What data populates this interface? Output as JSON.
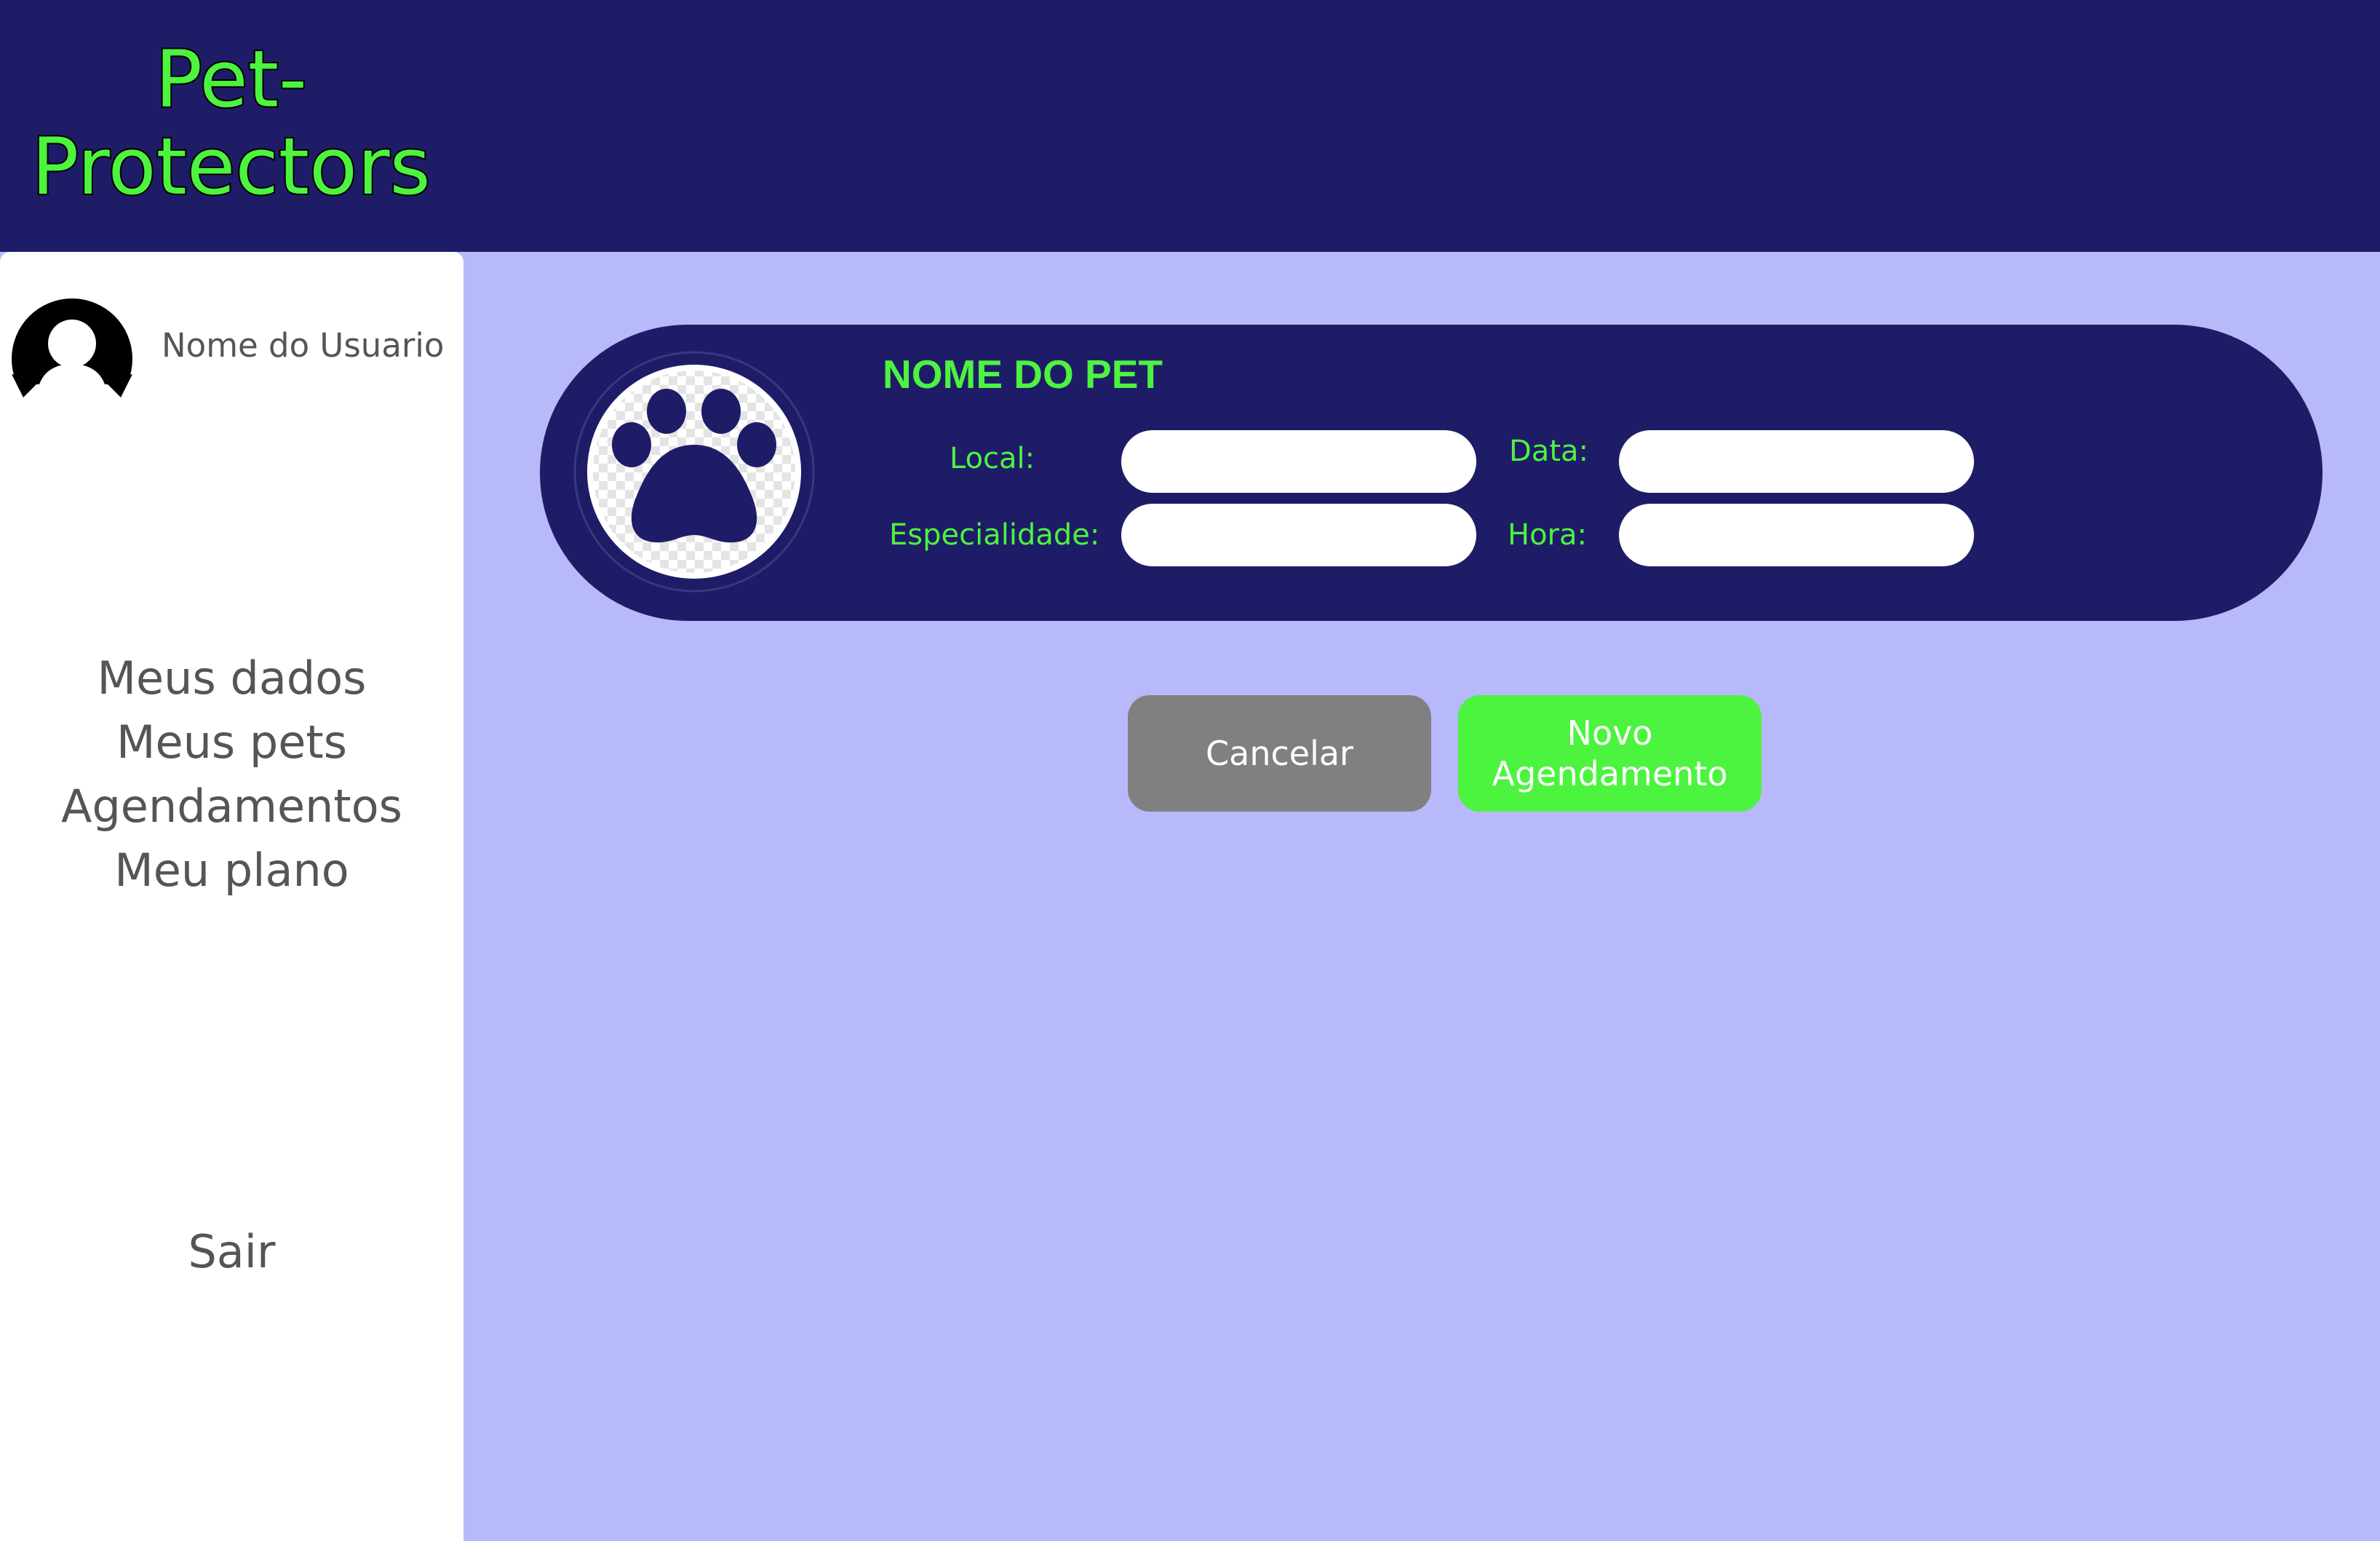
{
  "app": {
    "logo_line1": "Pet-",
    "logo_line2": "Protectors"
  },
  "sidebar": {
    "user_name": "Nome do Usuario",
    "items": [
      {
        "label": "Meus dados"
      },
      {
        "label": "Meus pets"
      },
      {
        "label": "Agendamentos"
      },
      {
        "label": "Meu plano"
      }
    ],
    "logout_label": "Sair"
  },
  "appointment": {
    "pet_name": "NOME DO PET",
    "fields": {
      "local": {
        "label": "Local:",
        "value": ""
      },
      "especialidade": {
        "label": "Especialidade:",
        "value": ""
      },
      "data": {
        "label": "Data:",
        "value": ""
      },
      "hora": {
        "label": "Hora:",
        "value": ""
      }
    }
  },
  "actions": {
    "cancel_label": "Cancelar",
    "new_line1": "Novo",
    "new_line2": "Agendamento"
  },
  "colors": {
    "header": "#1f1c67",
    "accent_green": "#4cf33f",
    "background": "#b7b9fa",
    "cancel_gray": "#808080"
  }
}
